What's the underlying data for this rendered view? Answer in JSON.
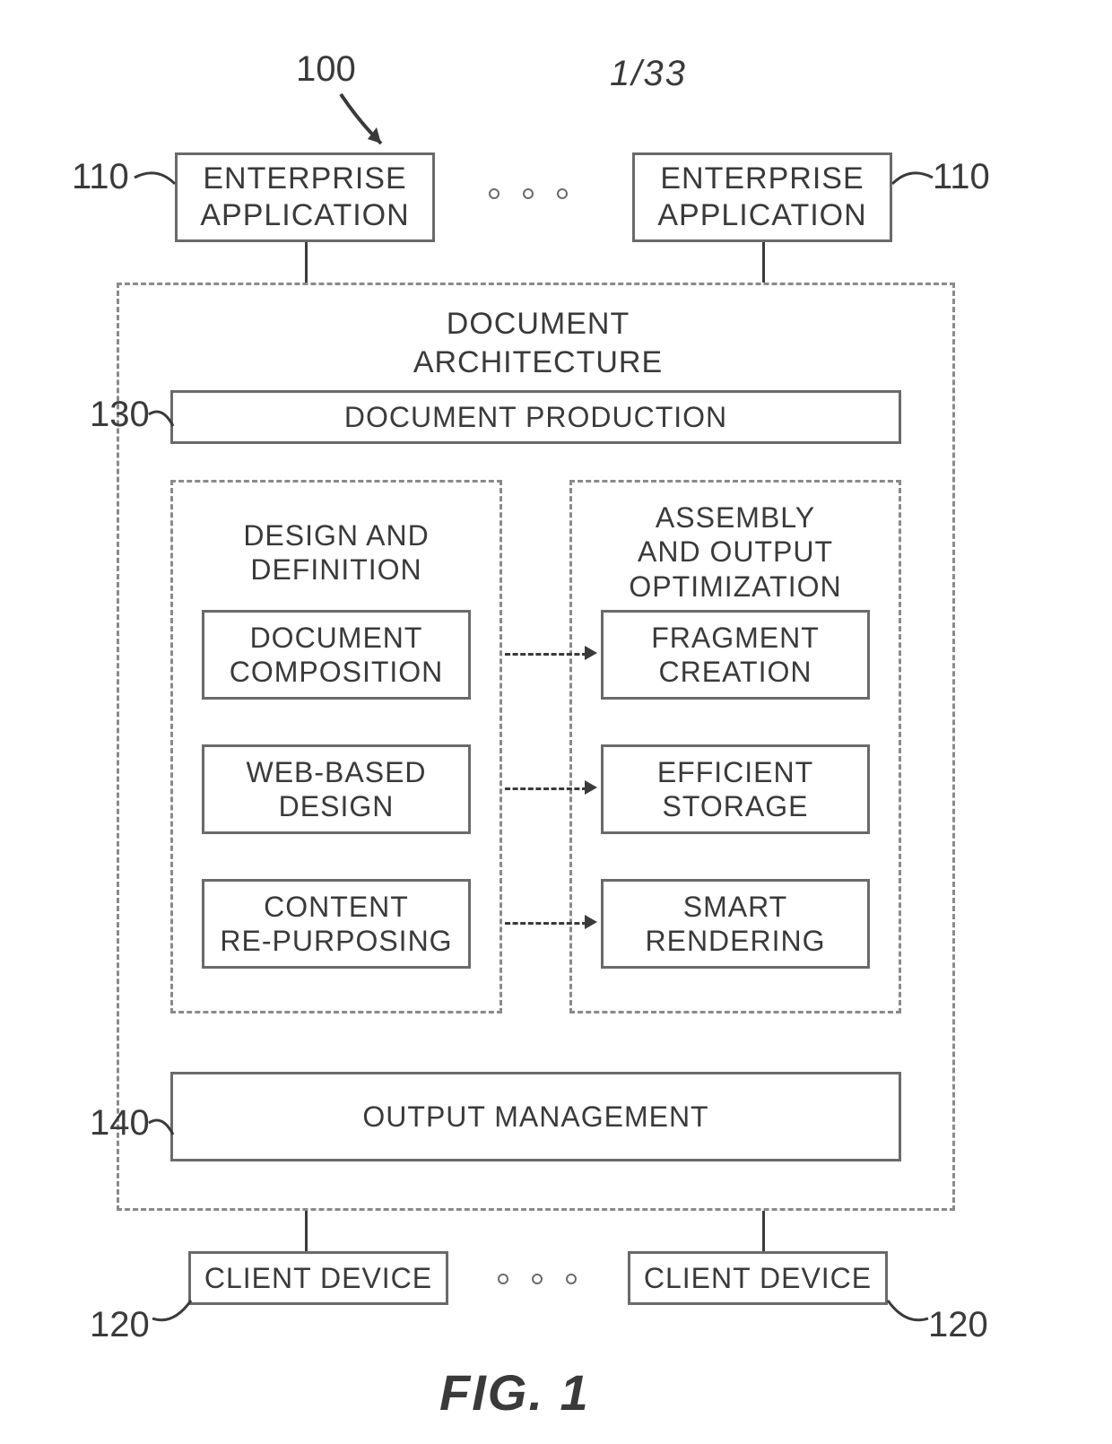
{
  "page_number": "1/33",
  "figure_label": "FIG. 1",
  "refs": {
    "r100": "100",
    "r110a": "110",
    "r110b": "110",
    "r130": "130",
    "r140": "140",
    "r120a": "120",
    "r120b": "120"
  },
  "top": {
    "ent_app_left": "ENTERPRISE\nAPPLICATION",
    "ent_app_right": "ENTERPRISE\nAPPLICATION"
  },
  "architecture": {
    "title": "DOCUMENT\nARCHITECTURE",
    "doc_production": "DOCUMENT PRODUCTION",
    "left_col": {
      "title": "DESIGN AND\nDEFINITION",
      "items": [
        "DOCUMENT\nCOMPOSITION",
        "WEB-BASED\nDESIGN",
        "CONTENT\nRE-PURPOSING"
      ]
    },
    "right_col": {
      "title": "ASSEMBLY\nAND OUTPUT\nOPTIMIZATION",
      "items": [
        "FRAGMENT\nCREATION",
        "EFFICIENT\nSTORAGE",
        "SMART\nRENDERING"
      ]
    },
    "output_mgmt": "OUTPUT MANAGEMENT"
  },
  "bottom": {
    "client_left": "CLIENT DEVICE",
    "client_right": "CLIENT DEVICE"
  }
}
